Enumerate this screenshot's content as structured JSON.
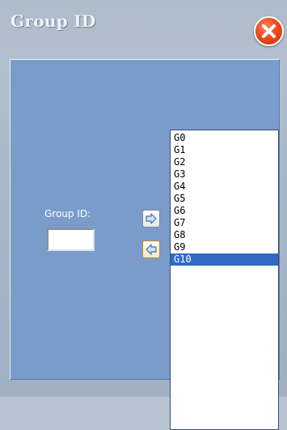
{
  "window": {
    "title": "Group ID",
    "close_icon": "close-icon"
  },
  "form": {
    "group_id_label": "Group ID:",
    "group_id_value": "",
    "add_button_icon": "arrow-right-icon",
    "remove_button_icon": "arrow-left-icon"
  },
  "list": {
    "items": [
      "G0",
      "G1",
      "G2",
      "G3",
      "G4",
      "G5",
      "G6",
      "G7",
      "G8",
      "G9",
      "G10"
    ],
    "selected": "G10"
  },
  "colors": {
    "panel": "#7a9ccb",
    "selection": "#316ac5",
    "close_button": "#f04a21"
  }
}
